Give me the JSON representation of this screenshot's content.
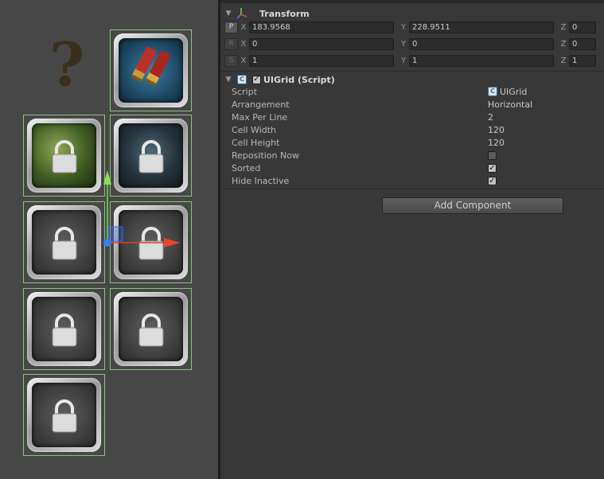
{
  "scene": {
    "placeholder_glyph": "?",
    "grid_color": "#8dc27d",
    "slots": [
      {
        "name": "shells-item",
        "type": "item",
        "bg": "blue"
      },
      {
        "name": "locked-hero-green",
        "type": "locked",
        "bg": "green"
      },
      {
        "name": "locked-hero-dark",
        "type": "locked",
        "bg": "dark"
      },
      {
        "name": "locked-empty",
        "type": "locked",
        "bg": "grey"
      },
      {
        "name": "locked-empty",
        "type": "locked",
        "bg": "grey"
      },
      {
        "name": "locked-empty",
        "type": "locked",
        "bg": "grey"
      },
      {
        "name": "locked-empty",
        "type": "locked",
        "bg": "grey"
      },
      {
        "name": "locked-empty",
        "type": "locked",
        "bg": "grey"
      }
    ]
  },
  "transform": {
    "title": "Transform",
    "rows": [
      {
        "button": "P",
        "x": "183.9568",
        "y": "228.9511",
        "z": "0"
      },
      {
        "button": "R",
        "x": "0",
        "y": "0",
        "z": "0"
      },
      {
        "button": "S",
        "x": "1",
        "y": "1",
        "z": "1"
      }
    ],
    "axis_x": "X",
    "axis_y": "Y",
    "axis_z": "Z"
  },
  "uigrid": {
    "title": "UIGrid (Script)",
    "enabled_check": "✓",
    "props": {
      "script_label": "Script",
      "script_value": "UIGrid",
      "arrangement_label": "Arrangement",
      "arrangement_value": "Horizontal",
      "max_per_line_label": "Max Per Line",
      "max_per_line_value": "2",
      "cell_width_label": "Cell Width",
      "cell_width_value": "120",
      "cell_height_label": "Cell Height",
      "cell_height_value": "120",
      "reposition_now_label": "Reposition Now",
      "sorted_label": "Sorted",
      "sorted_check": "✓",
      "hide_inactive_label": "Hide Inactive",
      "hide_inactive_check": "✓"
    }
  },
  "add_component_label": "Add Component"
}
